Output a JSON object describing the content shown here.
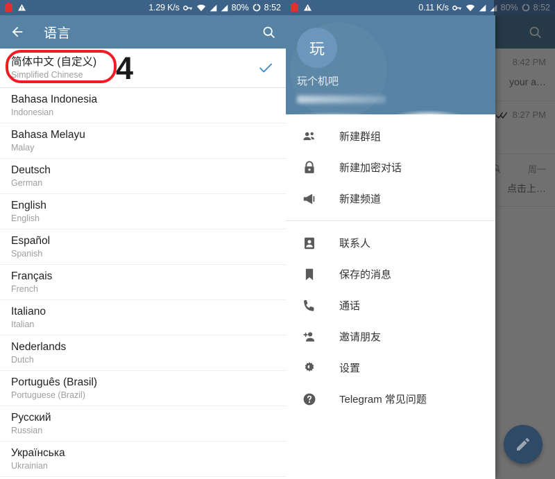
{
  "left_panel": {
    "status_bar": {
      "network_speed": "1.29 K/s",
      "battery_percent": "80%",
      "time": "8:52",
      "icons": [
        "screen-record-icon",
        "warning-icon",
        "vpn-key-icon",
        "wifi-icon",
        "signal-icon",
        "signal-icon",
        "battery-circle-icon"
      ]
    },
    "appbar": {
      "back_icon": "back-arrow-icon",
      "title": "语言",
      "search_icon": "search-icon"
    },
    "annotation": {
      "step_number": "4",
      "box_color": "#ee1c24"
    },
    "languages": [
      {
        "name": "简体中文 (自定义)",
        "sub": "Simplified Chinese",
        "selected": true
      },
      {
        "name": "Bahasa Indonesia",
        "sub": "Indonesian",
        "selected": false
      },
      {
        "name": "Bahasa Melayu",
        "sub": "Malay",
        "selected": false
      },
      {
        "name": "Deutsch",
        "sub": "German",
        "selected": false
      },
      {
        "name": "English",
        "sub": "English",
        "selected": false
      },
      {
        "name": "Español",
        "sub": "Spanish",
        "selected": false
      },
      {
        "name": "Français",
        "sub": "French",
        "selected": false
      },
      {
        "name": "Italiano",
        "sub": "Italian",
        "selected": false
      },
      {
        "name": "Nederlands",
        "sub": "Dutch",
        "selected": false
      },
      {
        "name": "Português (Brasil)",
        "sub": "Portuguese (Brazil)",
        "selected": false
      },
      {
        "name": "Русский",
        "sub": "Russian",
        "selected": false
      },
      {
        "name": "Українська",
        "sub": "Ukrainian",
        "selected": false
      }
    ],
    "checkmark_color": "#3e8ecc"
  },
  "right_panel": {
    "status_bar": {
      "network_speed": "0.11 K/s",
      "battery_percent": "80%",
      "time": "8:52"
    },
    "appbar": {
      "search_icon": "search-icon"
    },
    "drawer": {
      "avatar_initial": "玩",
      "profile_name": "玩个机吧",
      "phone_masked": "",
      "menu_groups": [
        [
          {
            "icon": "group-people-icon",
            "label": "新建群组"
          },
          {
            "icon": "lock-icon",
            "label": "新建加密对话"
          },
          {
            "icon": "megaphone-icon",
            "label": "新建频道"
          }
        ],
        [
          {
            "icon": "contact-card-icon",
            "label": "联系人"
          },
          {
            "icon": "bookmark-icon",
            "label": "保存的消息"
          },
          {
            "icon": "phone-icon",
            "label": "通话"
          },
          {
            "icon": "person-add-icon",
            "label": "邀请朋友"
          },
          {
            "icon": "gear-icon",
            "label": "设置"
          },
          {
            "icon": "help-circle-icon",
            "label": "Telegram 常见问题"
          }
        ]
      ]
    },
    "chat_list": [
      {
        "time": "8:42 PM",
        "snippet": "your a…",
        "read_icon": "",
        "muted": false
      },
      {
        "time": "8:27 PM",
        "snippet": "",
        "read_icon": "double-check-icon",
        "muted": false
      },
      {
        "time": "周一",
        "snippet": "点击上…",
        "read_icon": "",
        "muted": true
      }
    ],
    "fab": {
      "icon": "pencil-icon",
      "color": "#2e4a66"
    }
  }
}
